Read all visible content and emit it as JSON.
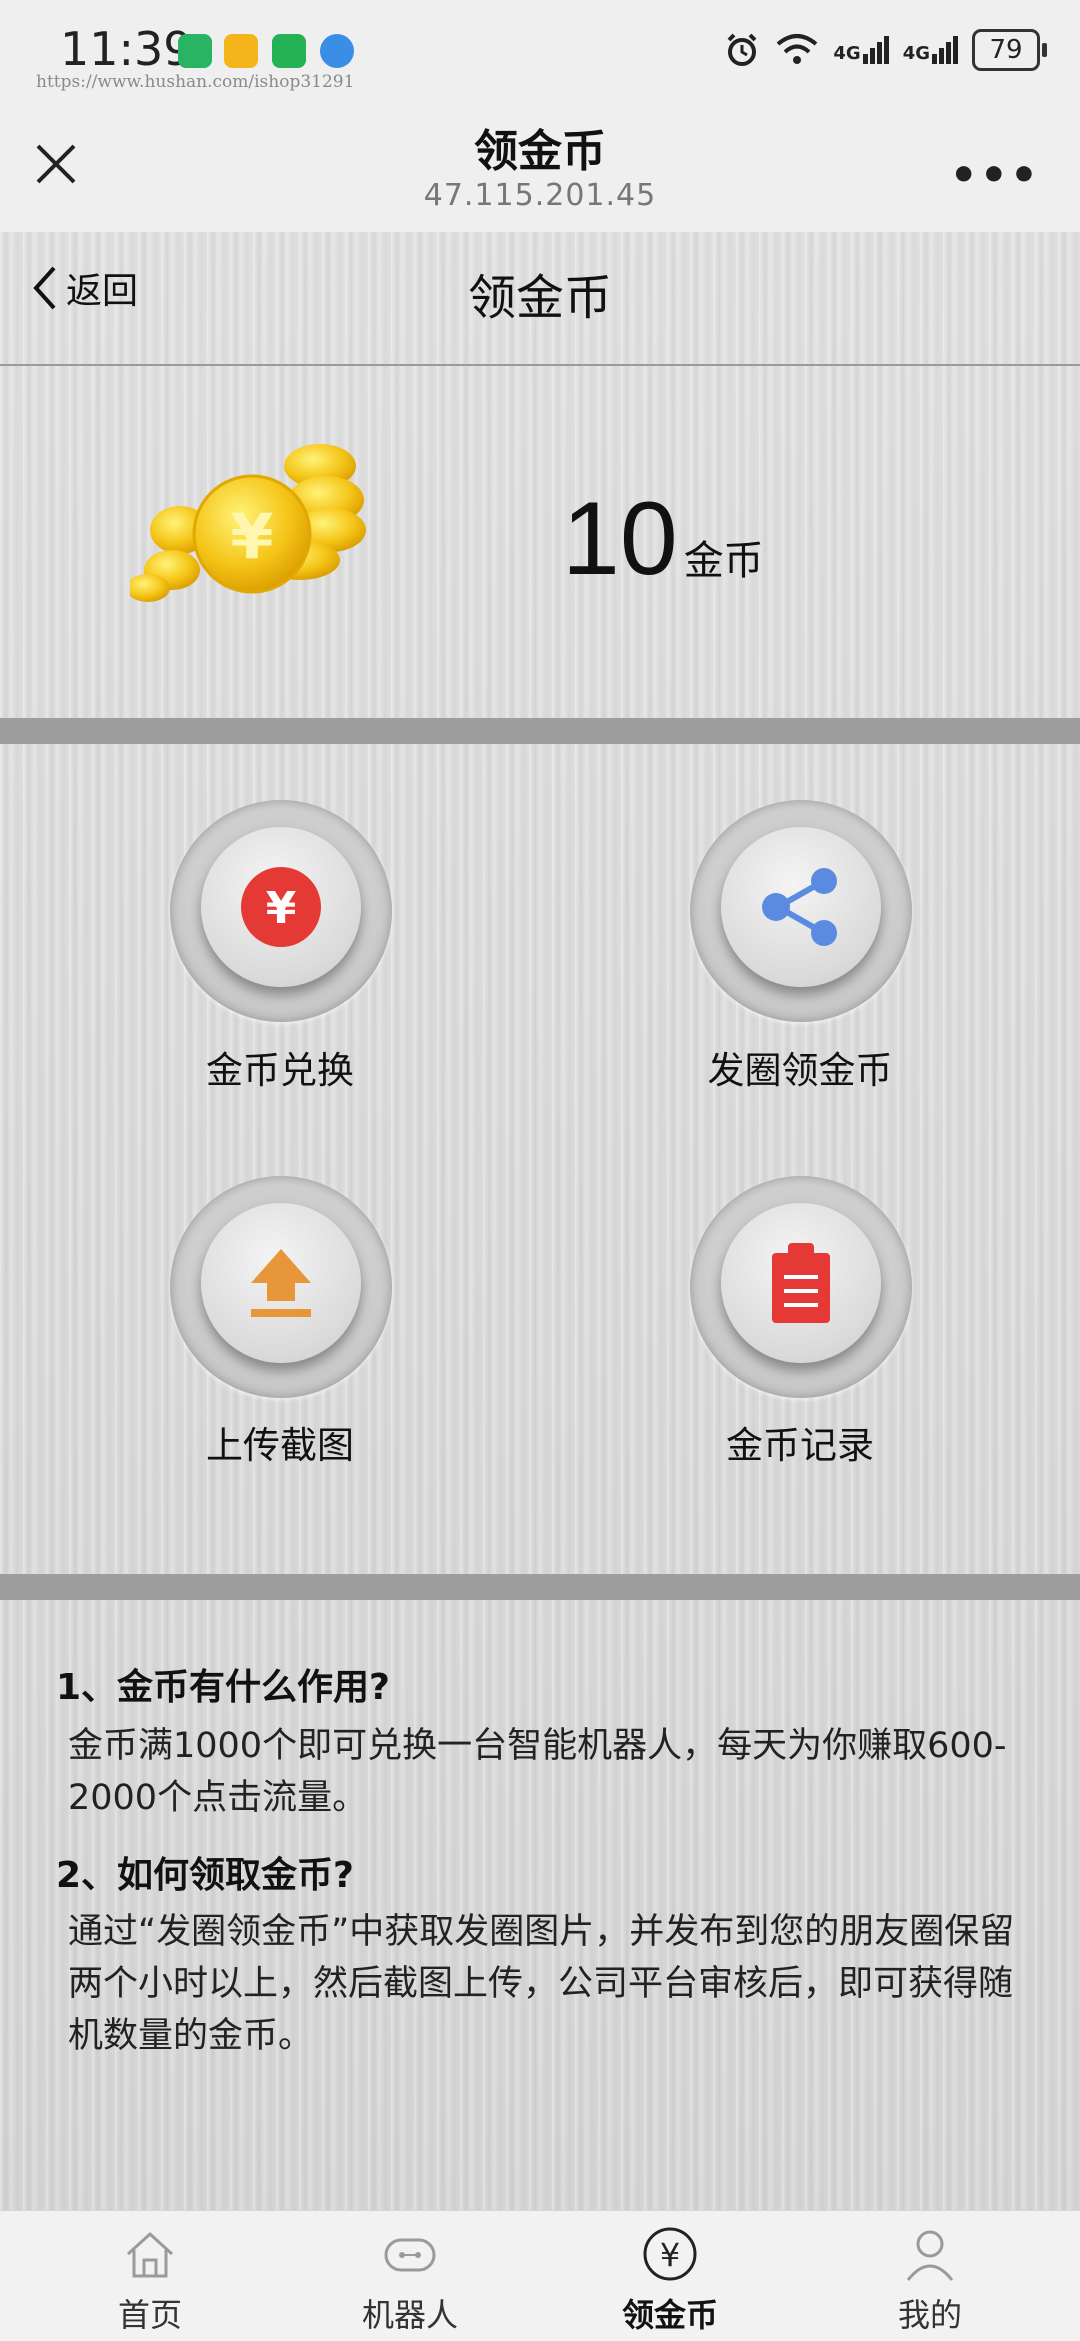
{
  "status_bar": {
    "time": "11:39",
    "watermark": "https://www.hushan.com/ishop31291",
    "network_1": "4G",
    "network_2": "4G",
    "battery": "79"
  },
  "webview": {
    "title": "领金币",
    "subtitle": "47.115.201.45"
  },
  "nav": {
    "back_label": "返回",
    "title": "领金币"
  },
  "balance": {
    "amount": "10",
    "unit": "金币"
  },
  "actions": [
    {
      "label": "金币兑换",
      "icon": "yen-coin-icon",
      "color": "#e53935"
    },
    {
      "label": "发圈领金币",
      "icon": "share-icon",
      "color": "#5b8be0"
    },
    {
      "label": "上传截图",
      "icon": "upload-icon",
      "color": "#e8963a"
    },
    {
      "label": "金币记录",
      "icon": "clipboard-icon",
      "color": "#e53935"
    }
  ],
  "faq": [
    {
      "question": "1、金币有什么作用?",
      "answer": "金币满1000个即可兑换一台智能机器人，每天为你赚取600-2000个点击流量。"
    },
    {
      "question": "2、如何领取金币?",
      "answer": "通过“发圈领金币”中获取发圈图片，并发布到您的朋友圈保留两个小时以上，然后截图上传，公司平台审核后，即可获得随机数量的金币。"
    }
  ],
  "tabs": [
    {
      "label": "首页",
      "icon": "home-icon",
      "active": false
    },
    {
      "label": "机器人",
      "icon": "robot-icon",
      "active": false
    },
    {
      "label": "领金币",
      "icon": "yen-icon",
      "active": true
    },
    {
      "label": "我的",
      "icon": "user-icon",
      "active": false
    }
  ]
}
